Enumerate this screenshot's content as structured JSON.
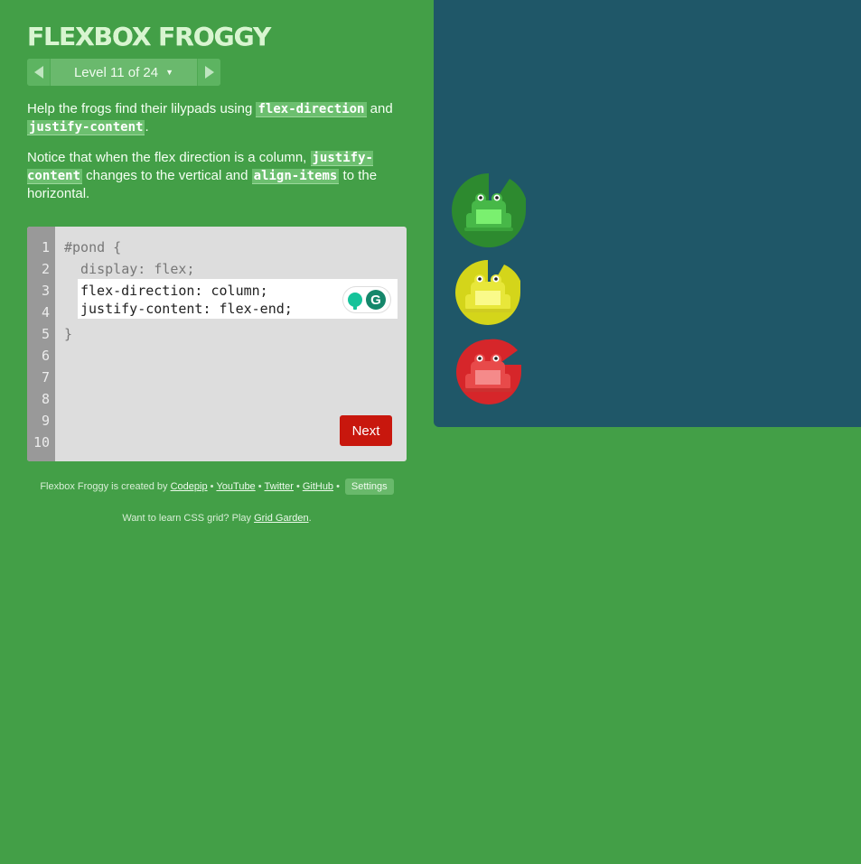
{
  "app": {
    "title": "FLEXBOX FROGGY",
    "level_label": "Level 11 of 24"
  },
  "instructions": {
    "p1_a": "Help the frogs find their lilypads using ",
    "p1_code1": "flex-direction",
    "p1_b": " and ",
    "p1_code2": "justify-content",
    "p1_c": ".",
    "p2_a": "Notice that when the flex direction is a column, ",
    "p2_code1": "justify-content",
    "p2_b": " changes to the vertical and ",
    "p2_code2": "align-items",
    "p2_c": " to the horizontal."
  },
  "editor": {
    "line_numbers": [
      "1",
      "2",
      "3",
      "4",
      "5",
      "6",
      "7",
      "8",
      "9",
      "10"
    ],
    "line1": "#pond {",
    "line2": "  display: flex;",
    "input_value": "flex-direction: column;\njustify-content: flex-end;",
    "line5": "}",
    "next_label": "Next"
  },
  "credits": {
    "prefix": "Flexbox Froggy is created by ",
    "codepip": "Codepip",
    "youtube": "YouTube",
    "twitter": "Twitter",
    "github": "GitHub",
    "bullet": "•",
    "settings": "Settings"
  },
  "grid_note": {
    "prefix": "Want to learn CSS grid? Play ",
    "link": "Grid Garden",
    "suffix": "."
  },
  "pond": {
    "frogs": [
      {
        "color": "green",
        "pad": "#2d8a2f",
        "body": "#5ed05c"
      },
      {
        "color": "yellow",
        "pad": "#d4d51a",
        "body": "#f4f45a"
      },
      {
        "color": "red",
        "pad": "#d6262a",
        "body": "#f06262"
      }
    ]
  }
}
